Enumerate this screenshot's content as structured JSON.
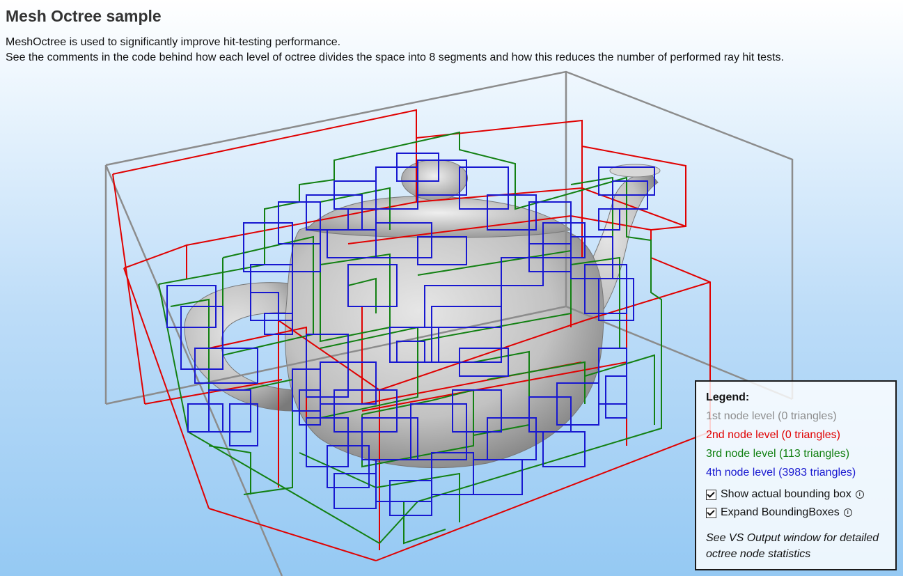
{
  "page": {
    "title": "Mesh Octree sample",
    "description_line1": "MeshOctree is used to significantly improve hit-testing performance.",
    "description_line2": "See the comments in the code behind how each level of octree divides the space into 8 segments and how this reduces the number of performed ray hit tests."
  },
  "legend": {
    "title": "Legend:",
    "levels": [
      {
        "label": "1st node level (0 triangles)",
        "color": "#8c8c8c"
      },
      {
        "label": "2nd node level (0 triangles)",
        "color": "#e00000"
      },
      {
        "label": "3rd node level (113 triangles)",
        "color": "#128012"
      },
      {
        "label": "4th node level (3983 triangles)",
        "color": "#1818d0"
      }
    ],
    "options": [
      {
        "label": "Show actual bounding box",
        "checked": true,
        "icon": "info-icon"
      },
      {
        "label": "Expand BoundingBoxes",
        "checked": true,
        "icon": "info-icon"
      }
    ],
    "note": "See VS Output window for detailed octree node statistics"
  },
  "scene": {
    "model": "teapot",
    "model_color": "#c0c0c0"
  }
}
